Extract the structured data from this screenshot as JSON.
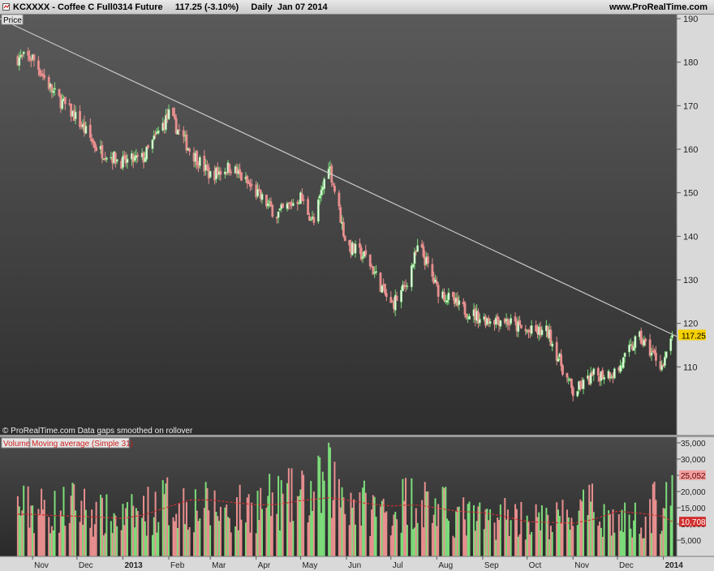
{
  "header": {
    "title": "KCXXXX - Coffee C Full0314 Future     117.25 (-3.10%)     Daily  Jan 07 2014",
    "website": "www.ProRealTime.com"
  },
  "price_panel": {
    "tag": "Price",
    "footer": "© ProRealTime.com  Data gaps smoothed on rollover",
    "last_price_label": "117.25"
  },
  "volume_panel": {
    "tag_volume": "Volume",
    "tag_ma": "Moving average (Simple 31)",
    "volume_value_label": "25,052",
    "ma_value_label": "10,708"
  },
  "colors": {
    "background_top": "#5a5a5a",
    "background_bottom": "#303030",
    "up": "#7ddc7a",
    "down": "#e88f8f",
    "trendline": "#c8c8c8",
    "ma_line": "#d03030",
    "last_price_badge": "#f5d000"
  },
  "chart_data": [
    {
      "type": "candlestick",
      "title": "KCXXXX - Coffee C Full0314 Future",
      "ylim": [
        100,
        190
      ],
      "yticks": [
        "190",
        "180",
        "170",
        "160",
        "150",
        "140",
        "130",
        "120",
        "110"
      ],
      "xticks": [
        "Nov",
        "Dec",
        "2013",
        "Feb",
        "Mar",
        "Apr",
        "May",
        "Jun",
        "Jul",
        "Aug",
        "Sep",
        "Oct",
        "Nov",
        "Dec",
        "2014"
      ],
      "x": [
        "2012-11-01",
        "2012-11-15",
        "2012-12-01",
        "2012-12-15",
        "2013-01-01",
        "2013-01-15",
        "2013-02-01",
        "2013-02-15",
        "2013-03-01",
        "2013-03-15",
        "2013-04-01",
        "2013-04-15",
        "2013-05-01",
        "2013-05-10",
        "2013-05-20",
        "2013-06-01",
        "2013-06-15",
        "2013-07-01",
        "2013-07-10",
        "2013-07-20",
        "2013-08-01",
        "2013-08-15",
        "2013-09-01",
        "2013-09-15",
        "2013-10-01",
        "2013-10-15",
        "2013-11-01",
        "2013-11-15",
        "2013-12-01",
        "2013-12-15",
        "2014-01-01",
        "2014-01-07"
      ],
      "close": [
        181,
        173,
        167,
        160,
        157,
        158,
        168,
        160,
        154,
        156,
        150,
        145,
        149,
        143,
        157,
        138,
        135,
        124,
        128,
        138,
        128,
        124,
        121,
        121,
        118,
        118,
        104,
        108,
        109,
        117,
        110,
        117.25
      ],
      "last_price": 117.25,
      "trendline": {
        "from": {
          "x": "2012-10-10",
          "y": 190
        },
        "to": {
          "x": "2014-01-10",
          "y": 117
        }
      },
      "footer": "© ProRealTime.com  Data gaps smoothed on rollover"
    },
    {
      "type": "bar",
      "title": "Volume",
      "ylim": [
        0,
        36000
      ],
      "yticks": [
        "35,000",
        "30,000",
        "25,000",
        "20,000",
        "15,000",
        "10,000",
        "5,000"
      ],
      "series": [
        {
          "name": "Volume",
          "values": [
            14000,
            13000,
            15000,
            12000,
            11000,
            13000,
            16000,
            15000,
            14000,
            13000,
            15000,
            16000,
            17000,
            18000,
            22000,
            18000,
            14000,
            13000,
            16000,
            17000,
            14000,
            12000,
            10000,
            12000,
            11000,
            10000,
            12000,
            14000,
            10000,
            11000,
            16000,
            25052
          ]
        },
        {
          "name": "Moving average (Simple 31)",
          "values": [
            13000,
            12600,
            12400,
            12100,
            11700,
            12800,
            15300,
            17400,
            17400,
            16700,
            15900,
            16000,
            17200,
            17600,
            18100,
            17400,
            16300,
            15500,
            15800,
            15800,
            14900,
            13900,
            13500,
            12400,
            10700,
            10500,
            10200,
            11400,
            13900,
            13400,
            12300,
            10708
          ]
        }
      ]
    }
  ]
}
